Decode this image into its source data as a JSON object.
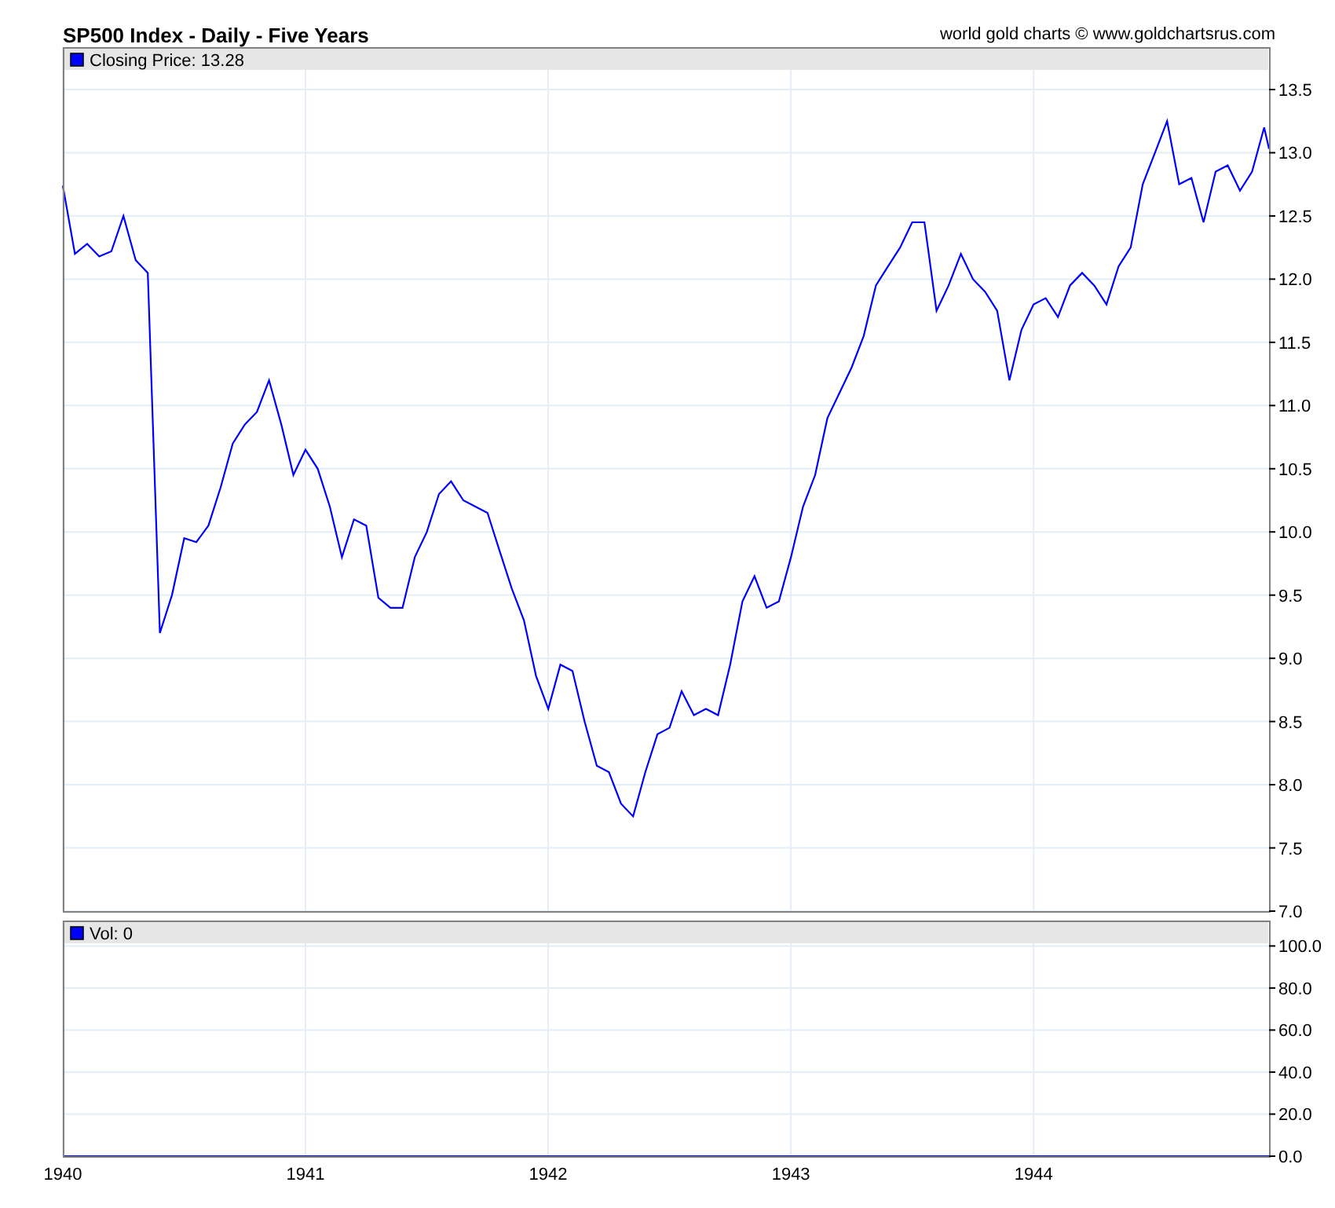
{
  "header": {
    "title": "SP500 Index - Daily - Five Years",
    "credit": "world gold charts © www.goldchartsrus.com"
  },
  "price_panel": {
    "legend": "Closing Price: 13.28",
    "chart_data": {
      "type": "line",
      "grid": true,
      "xlim": [
        1940,
        1944.97
      ],
      "ylim": [
        7.0,
        13.5
      ],
      "x": [
        1940,
        1940.05,
        1940.1,
        1940.15,
        1940.2,
        1940.25,
        1940.3,
        1940.35,
        1940.4,
        1940.45,
        1940.5,
        1940.55,
        1940.6,
        1940.65,
        1940.7,
        1940.75,
        1940.8,
        1940.85,
        1940.9,
        1940.95,
        1941,
        1941.05,
        1941.1,
        1941.15,
        1941.2,
        1941.25,
        1941.3,
        1941.35,
        1941.4,
        1941.45,
        1941.5,
        1941.55,
        1941.6,
        1941.65,
        1941.7,
        1941.75,
        1941.8,
        1941.85,
        1941.9,
        1941.95,
        1942,
        1942.05,
        1942.1,
        1942.15,
        1942.2,
        1942.25,
        1942.3,
        1942.35,
        1942.4,
        1942.45,
        1942.5,
        1942.55,
        1942.6,
        1942.65,
        1942.7,
        1942.75,
        1942.8,
        1942.85,
        1942.9,
        1942.95,
        1943,
        1943.05,
        1943.1,
        1943.15,
        1943.2,
        1943.25,
        1943.3,
        1943.35,
        1943.4,
        1943.45,
        1943.5,
        1943.55,
        1943.6,
        1943.65,
        1943.7,
        1943.75,
        1943.8,
        1943.85,
        1943.9,
        1943.95,
        1944,
        1944.05,
        1944.1,
        1944.15,
        1944.2,
        1944.25,
        1944.3,
        1944.35,
        1944.4,
        1944.45,
        1944.5,
        1944.55,
        1944.6,
        1944.65,
        1944.7,
        1944.75,
        1944.8,
        1944.85,
        1944.9,
        1944.95,
        1944.97
      ],
      "series": [
        {
          "color": "#0000ff",
          "values": [
            12.74,
            12.2,
            12.28,
            12.18,
            12.22,
            12.5,
            12.15,
            12.05,
            9.2,
            9.5,
            9.95,
            9.92,
            10.05,
            10.35,
            10.7,
            10.85,
            10.95,
            11.2,
            10.85,
            10.45,
            10.65,
            10.5,
            10.2,
            9.8,
            10.1,
            10.05,
            9.48,
            9.4,
            9.4,
            9.8,
            10.0,
            10.3,
            10.4,
            10.25,
            10.2,
            10.15,
            9.85,
            9.55,
            9.3,
            8.86,
            8.6,
            8.95,
            8.9,
            8.5,
            8.15,
            8.1,
            7.85,
            7.75,
            8.1,
            8.4,
            8.45,
            8.74,
            8.55,
            8.6,
            8.55,
            8.95,
            9.45,
            9.65,
            9.4,
            9.45,
            9.8,
            10.2,
            10.45,
            10.9,
            11.1,
            11.3,
            11.55,
            11.95,
            12.1,
            12.25,
            12.45,
            12.45,
            11.75,
            11.95,
            12.2,
            12.0,
            11.9,
            11.75,
            11.2,
            11.6,
            11.8,
            11.85,
            11.7,
            11.95,
            12.05,
            11.95,
            11.8,
            12.1,
            12.25,
            12.75,
            13.0,
            13.25,
            12.75,
            12.8,
            12.45,
            12.85,
            12.9,
            12.7,
            12.85,
            13.2,
            13.03
          ]
        }
      ],
      "yticks": [
        {
          "value": 7,
          "label": "7.0"
        },
        {
          "value": 7.5,
          "label": "7.5"
        },
        {
          "value": 8,
          "label": "8.0"
        },
        {
          "value": 8.5,
          "label": "8.5"
        },
        {
          "value": 9,
          "label": "9.0"
        },
        {
          "value": 9.5,
          "label": "9.5"
        },
        {
          "value": 10,
          "label": "10.0"
        },
        {
          "value": 10.5,
          "label": "10.5"
        },
        {
          "value": 11,
          "label": "11.0"
        },
        {
          "value": 11.5,
          "label": "11.5"
        },
        {
          "value": 12,
          "label": "12.0"
        },
        {
          "value": 12.5,
          "label": "12.5"
        },
        {
          "value": 13,
          "label": "13.0"
        },
        {
          "value": 13.5,
          "label": "13.5"
        }
      ]
    }
  },
  "volume_panel": {
    "legend": "Vol: 0",
    "chart_data": {
      "type": "line",
      "grid": true,
      "xlim": [
        1940,
        1944.97
      ],
      "ylim": [
        0,
        100
      ],
      "x": [
        1940,
        1944.97
      ],
      "series": [
        {
          "color": "#0000ff",
          "values": [
            0,
            0
          ]
        }
      ],
      "yticks": [
        {
          "value": 0,
          "label": "0.0"
        },
        {
          "value": 20,
          "label": "20.0"
        },
        {
          "value": 40,
          "label": "40.0"
        },
        {
          "value": 60,
          "label": "60.0"
        },
        {
          "value": 80,
          "label": "80.0"
        },
        {
          "value": 100,
          "label": "100.0"
        }
      ],
      "xticks": [
        {
          "value": 1940,
          "label": "1940"
        },
        {
          "value": 1941,
          "label": "1941"
        },
        {
          "value": 1942,
          "label": "1942"
        },
        {
          "value": 1943,
          "label": "1943"
        },
        {
          "value": 1944,
          "label": "1944"
        }
      ]
    }
  }
}
